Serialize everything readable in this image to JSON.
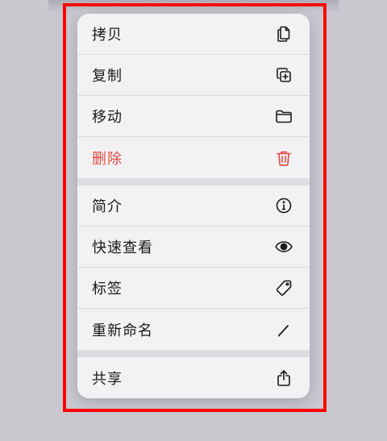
{
  "menu": {
    "groups": [
      {
        "items": [
          {
            "label": "拷贝",
            "icon": "copy-icon"
          },
          {
            "label": "复制",
            "icon": "duplicate-icon"
          },
          {
            "label": "移动",
            "icon": "folder-icon"
          },
          {
            "label": "删除",
            "icon": "trash-icon",
            "destructive": true
          }
        ]
      },
      {
        "items": [
          {
            "label": "简介",
            "icon": "info-icon"
          },
          {
            "label": "快速查看",
            "icon": "eye-icon"
          },
          {
            "label": "标签",
            "icon": "tag-icon"
          },
          {
            "label": "重新命名",
            "icon": "pencil-icon"
          }
        ]
      },
      {
        "items": [
          {
            "label": "共享",
            "icon": "share-icon"
          }
        ]
      }
    ]
  },
  "colors": {
    "text": "#1b1b1d",
    "destructive": "#e5493f",
    "menu_background": "#f2f2f5",
    "page_background": "#c9c8cf",
    "highlight_border": "#ff0000"
  }
}
